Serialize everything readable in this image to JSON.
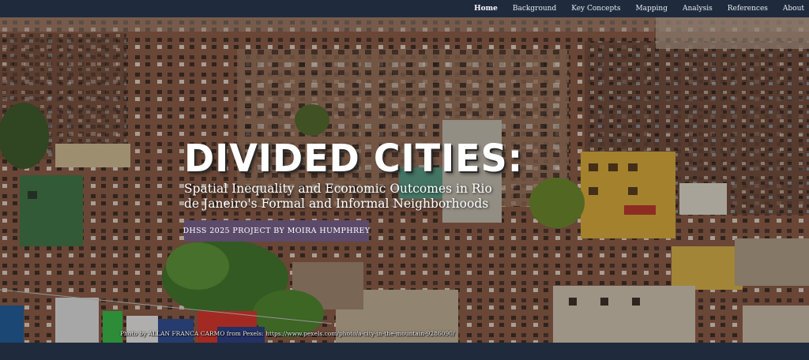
{
  "nav": {
    "items": [
      {
        "label": "Home",
        "active": true
      },
      {
        "label": "Background"
      },
      {
        "label": "Key Concepts"
      },
      {
        "label": "Mapping"
      },
      {
        "label": "Analysis"
      },
      {
        "label": "References"
      },
      {
        "label": "About"
      }
    ]
  },
  "hero": {
    "title": "DIVIDED CITIES:",
    "subtitle": "Spatial Inequality and Economic Outcomes in Rio de Janeiro's Formal and Informal Neighborhoods",
    "badge": "DHSS 2025 PROJECT BY MOIRA HUMPHREY",
    "credit_prefix": "Photo by ALLAN FRANCA CARMO from Pexels: ",
    "credit_link": "https://www.pexels.com/photo/a-city-in-the-mountain-9286090/"
  },
  "colors": {
    "navbar": "#1f2b3d",
    "badge": "#5b4a6a",
    "text": "#ffffff"
  }
}
